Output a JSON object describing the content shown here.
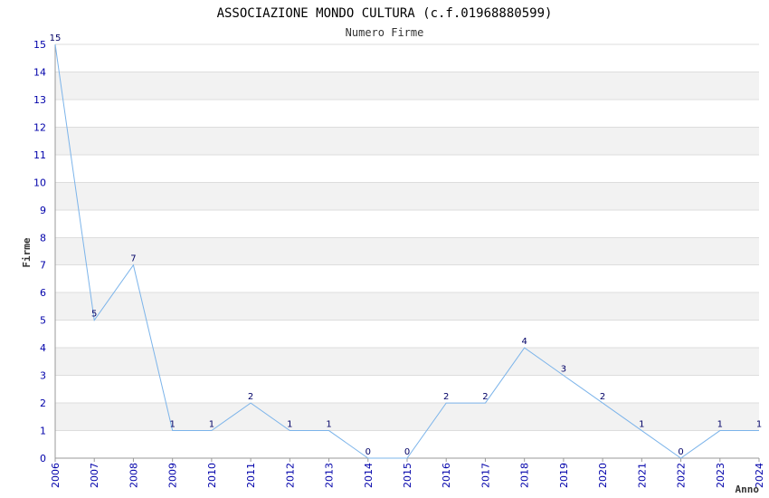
{
  "chart_data": {
    "type": "line",
    "title": "ASSOCIAZIONE MONDO CULTURA (c.f.01968880599)",
    "subtitle": "Numero Firme",
    "xlabel": "Anno",
    "ylabel": "Firme",
    "x": [
      "2006",
      "2007",
      "2008",
      "2009",
      "2010",
      "2011",
      "2012",
      "2013",
      "2014",
      "2015",
      "2016",
      "2017",
      "2018",
      "2019",
      "2020",
      "2021",
      "2022",
      "2023",
      "2024"
    ],
    "values": [
      15,
      5,
      7,
      1,
      1,
      2,
      1,
      1,
      0,
      0,
      2,
      2,
      4,
      3,
      2,
      1,
      0,
      1,
      1
    ],
    "ylim": [
      0,
      15
    ],
    "yticks": [
      0,
      1,
      2,
      3,
      4,
      5,
      6,
      7,
      8,
      9,
      10,
      11,
      12,
      13,
      14,
      15
    ],
    "grid": true,
    "colors": {
      "line": "#7cb4ea",
      "tick_text": "#0000aa",
      "band": "#f2f2f2",
      "grid": "#dddddd",
      "axis": "#999999",
      "data_label": "#000066"
    }
  }
}
